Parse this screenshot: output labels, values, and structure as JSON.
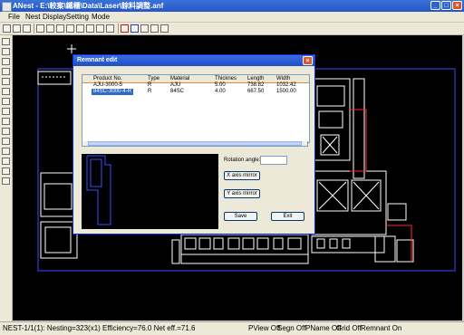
{
  "window": {
    "title": "ANest - E:\\較案\\鐵櫃\\Data\\Laser\\餘料調整.anf"
  },
  "menu": {
    "items": [
      "File",
      "Nest",
      "Display",
      "Setting",
      "Mode"
    ]
  },
  "status": {
    "main": "NEST-1/1(1):  Nesting=323(x1)  Efficiency=76.0  Net eff.=71.6",
    "flags": [
      "PView Off",
      "Segn Off",
      "PName Off",
      "Grid Off",
      "Remnant On"
    ]
  },
  "dialog": {
    "title": "Remnant edit",
    "columns": [
      "Product No.",
      "Type",
      "Material",
      "Thicknes",
      "Length",
      "Width"
    ],
    "rows": [
      [
        "AJU-3000-5",
        "R",
        "AJU",
        "5.00",
        "738.82",
        "1032.42"
      ],
      [
        "84SC-3000-4-R",
        "R",
        "84SC",
        "4.00",
        "667.50",
        "1500.00"
      ]
    ],
    "selected_row": 1,
    "rotation_label": "Rotation angle:",
    "rotation_value": "",
    "x_mirror_label": "X axis mirror",
    "y_mirror_label": "Y axis mirror",
    "save_label": "Save",
    "exit_label": "Exit"
  },
  "colors": {
    "title_blue": "#2357c6",
    "selection": "#316ac5",
    "canvas": "#000000",
    "sheet_outline": "#3b4cff",
    "part_white": "#ffffff",
    "part_red": "#ff2a2a"
  }
}
